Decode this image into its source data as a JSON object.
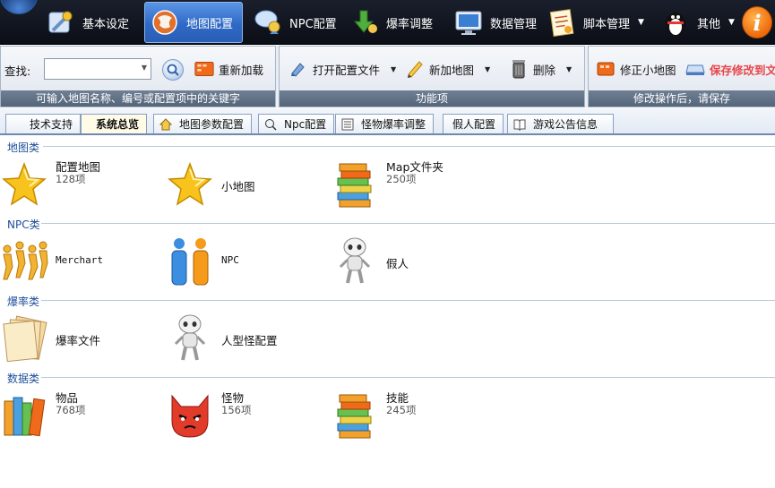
{
  "topbar": {
    "tabs": [
      {
        "label": "基本设定",
        "icon": "settings-icon"
      },
      {
        "label": "地图配置",
        "icon": "globe-icon",
        "active": true
      },
      {
        "label": "NPC配置",
        "icon": "npc-chat-icon"
      },
      {
        "label": "爆率调整",
        "icon": "drop-rate-icon"
      },
      {
        "label": "数据管理",
        "icon": "monitor-icon"
      },
      {
        "label": "脚本管理",
        "icon": "script-icon"
      },
      {
        "label": "其他",
        "icon": "penguin-icon"
      }
    ],
    "info_icon": "info-icon"
  },
  "search": {
    "label": "查找:",
    "value": "",
    "footer": "可输入地图名称、编号或配置项中的关键字"
  },
  "toolbar": {
    "reload_label": "重新加载",
    "open_config_label": "打开配置文件",
    "new_map_label": "新加地图",
    "delete_label": "删除",
    "function_footer": "功能项",
    "fix_minimap_label": "修正小地图",
    "save_label": "保存修改到文",
    "save_footer": "修改操作后，请保存"
  },
  "subtabs": [
    {
      "label": "技术支持"
    },
    {
      "label": "系统总览",
      "active": true
    },
    {
      "label": "地图参数配置"
    },
    {
      "label": "Npc配置"
    },
    {
      "label": "怪物爆率调整"
    },
    {
      "label": "假人配置"
    },
    {
      "label": "游戏公告信息"
    }
  ],
  "sections": {
    "map": {
      "title": "地图类",
      "items": [
        {
          "name": "配置地图",
          "count": "128项",
          "icon": "star-icon"
        },
        {
          "name": "小地图",
          "icon": "star-icon"
        },
        {
          "name": "Map文件夹",
          "count": "250项",
          "icon": "books-icon"
        }
      ]
    },
    "npc": {
      "title": "NPC类",
      "items": [
        {
          "name": "Merchart",
          "icon": "people-chain-icon"
        },
        {
          "name": "NPC",
          "icon": "two-people-icon"
        },
        {
          "name": "假人",
          "icon": "robot-icon"
        }
      ]
    },
    "drop": {
      "title": "爆率类",
      "items": [
        {
          "name": "爆率文件",
          "icon": "papers-icon"
        },
        {
          "name": "人型怪配置",
          "icon": "robot-icon"
        }
      ]
    },
    "data": {
      "title": "数据类",
      "items": [
        {
          "name": "物品",
          "count": "768项",
          "icon": "books-icon"
        },
        {
          "name": "怪物",
          "count": "156项",
          "icon": "red-cat-icon"
        },
        {
          "name": "技能",
          "count": "245项",
          "icon": "books-icon"
        }
      ]
    }
  },
  "colors": {
    "accent": "#2f69c6",
    "section_title": "#1f4e9a",
    "save_text": "#e8454a"
  }
}
